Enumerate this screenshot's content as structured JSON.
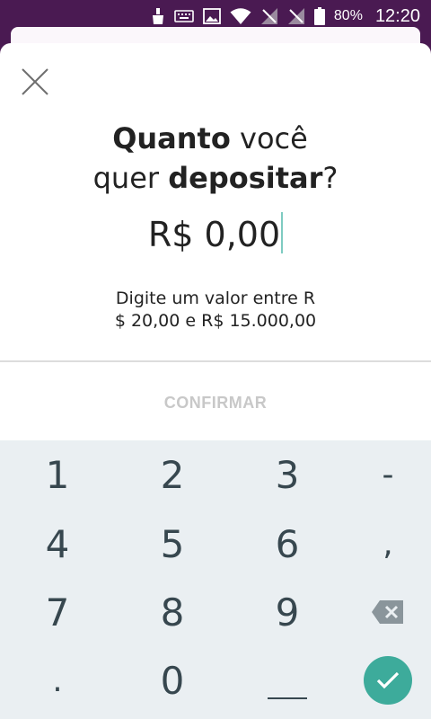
{
  "status_bar": {
    "battery_percent": "80%",
    "time": "12:20",
    "icons": [
      "cleaner-icon",
      "keyboard-icon",
      "image-icon",
      "wifi-icon",
      "no-signal-icon",
      "no-signal-icon",
      "battery-icon"
    ]
  },
  "sheet": {
    "title_word1_bold": "Quanto",
    "title_word1_rest": " você",
    "title_line2_pre": "quer ",
    "title_line2_bold": "depositar",
    "title_line2_post": "?",
    "amount": "R$ 0,00",
    "hint_line1": "Digite um valor entre R",
    "hint_line2": "$ 20,00 e R$ 15.000,00",
    "confirm_label": "CONFIRMAR"
  },
  "keypad": {
    "keys": [
      "1",
      "2",
      "3",
      "-",
      "4",
      "5",
      "6",
      ",",
      "7",
      "8",
      "9",
      ".",
      "0"
    ],
    "accent": "#3dab9b"
  },
  "colors": {
    "brand_purple": "#4a1a52",
    "caret": "#7ecbc1",
    "confirm_disabled": "#c8c8c8"
  }
}
